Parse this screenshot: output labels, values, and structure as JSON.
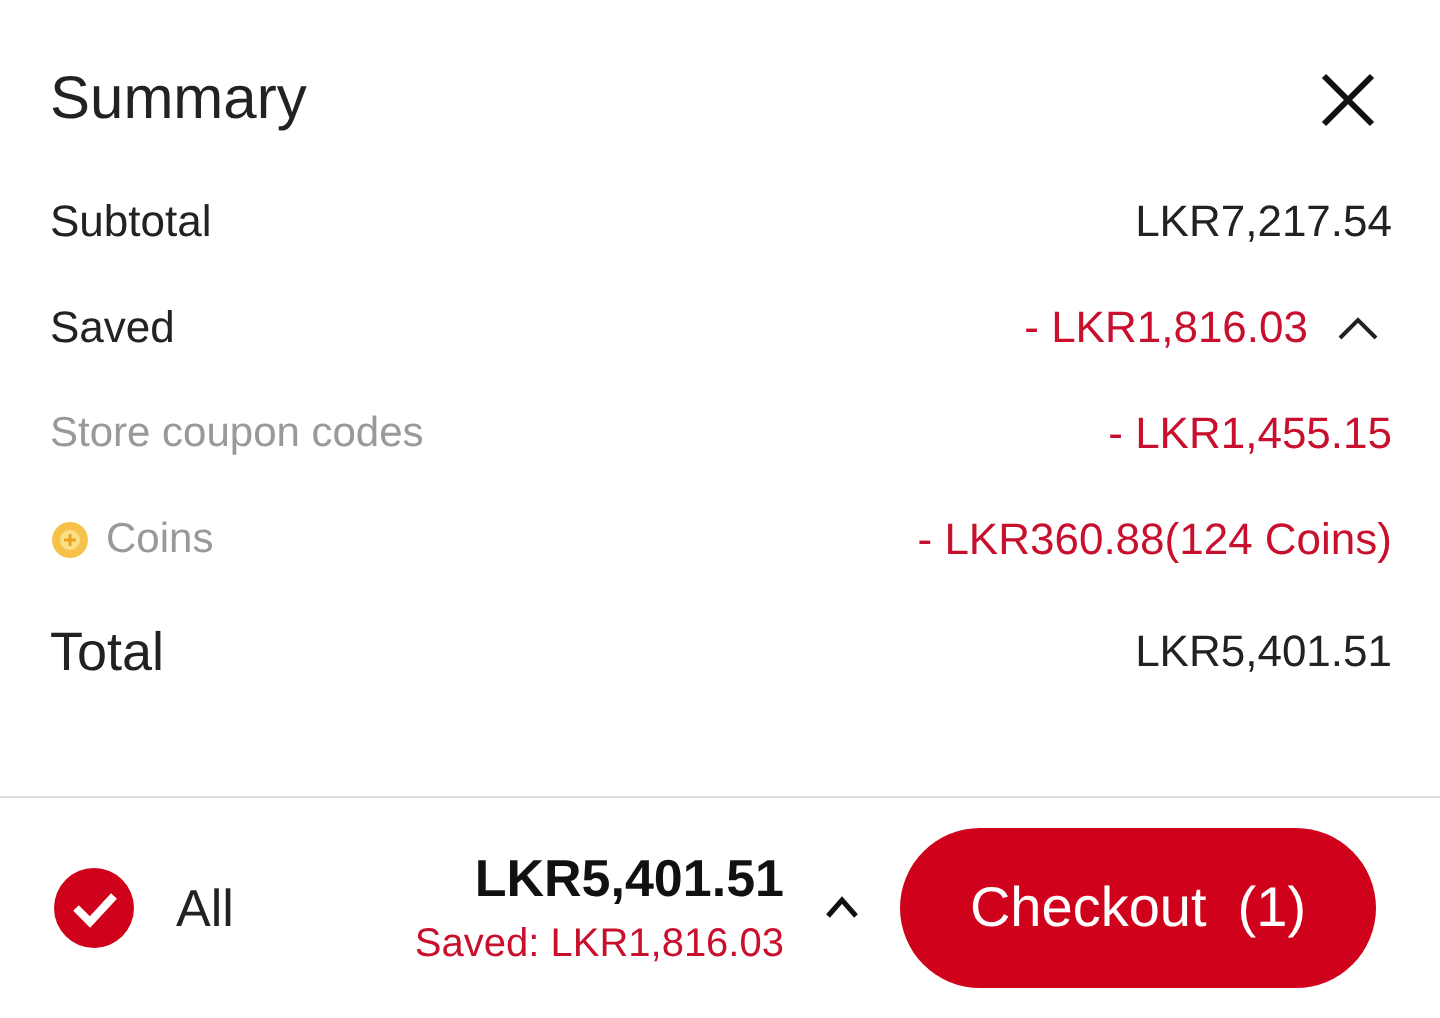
{
  "title": "Summary",
  "rows": [
    {
      "kind": "main",
      "label": "Subtotal",
      "value": "LKR7,217.54"
    },
    {
      "kind": "saved",
      "label": "Saved",
      "value": "- LKR1,816.03",
      "expanded": true
    },
    {
      "kind": "sub",
      "label": "Store coupon codes",
      "value": "- LKR1,455.15"
    },
    {
      "kind": "coins",
      "label": "Coins",
      "value": "- LKR360.88(124 Coins)"
    },
    {
      "kind": "total",
      "label": "Total",
      "value": "LKR5,401.51"
    }
  ],
  "footer": {
    "select_all": {
      "label": "All",
      "checked": true
    },
    "total": "LKR5,401.51",
    "saved": "Saved: LKR1,816.03",
    "expanded": false,
    "checkout": "Checkout  (1)"
  }
}
